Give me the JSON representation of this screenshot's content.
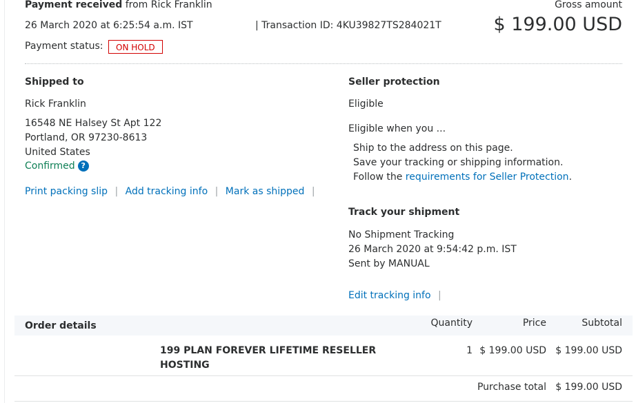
{
  "header": {
    "title_bold": "Payment received",
    "title_rest": "from Rick Franklin",
    "datetime": "26 March 2020 at 6:25:54 a.m. IST",
    "transaction_label": "| Transaction ID: 4KU39827TS284021T",
    "gross_label": "Gross amount",
    "gross_amount": "$ 199.00 USD",
    "status_label": "Payment status:",
    "status_badge": "ON HOLD"
  },
  "shipped_to": {
    "heading": "Shipped to",
    "name": "Rick Franklin",
    "address_line1": "16548 NE Halsey St Apt 122",
    "address_line2": "Portland, OR 97230-8613",
    "country": "United States",
    "confirmed": "Confirmed",
    "help_icon": "?"
  },
  "actions": {
    "print_packing_slip": "Print packing slip",
    "add_tracking_info": "Add tracking info",
    "mark_as_shipped": "Mark as shipped",
    "separator": "|"
  },
  "seller_protection": {
    "heading": "Seller protection",
    "status": "Eligible",
    "intro": "Eligible when you ...",
    "item1": "Ship to the address on this page.",
    "item2": "Save your tracking or shipping information.",
    "item3_prefix": "Follow the",
    "item3_link": "requirements for Seller Protection",
    "item3_suffix": "."
  },
  "tracking": {
    "heading": "Track your shipment",
    "status": "No Shipment Tracking",
    "datetime": "26 March 2020 at 9:54:42 p.m. IST",
    "sent_by": "Sent by MANUAL",
    "edit_link": "Edit tracking info",
    "separator": "|"
  },
  "order": {
    "heading": "Order details",
    "col_quantity": "Quantity",
    "col_price": "Price",
    "col_subtotal": "Subtotal",
    "item_name_line1": "199 PLAN FOREVER LIFETIME RESELLER",
    "item_name_line2": "HOSTING",
    "item_quantity": "1",
    "item_price": "$ 199.00 USD",
    "item_subtotal": "$ 199.00 USD",
    "purchase_total_label": "Purchase total",
    "purchase_total": "$ 199.00 USD"
  },
  "colors": {
    "link": "#0070ba",
    "on_hold": "#d20000",
    "confirmed": "#0e7f55",
    "text": "#2c2e2f"
  },
  "icons": {
    "help": "help-icon"
  }
}
